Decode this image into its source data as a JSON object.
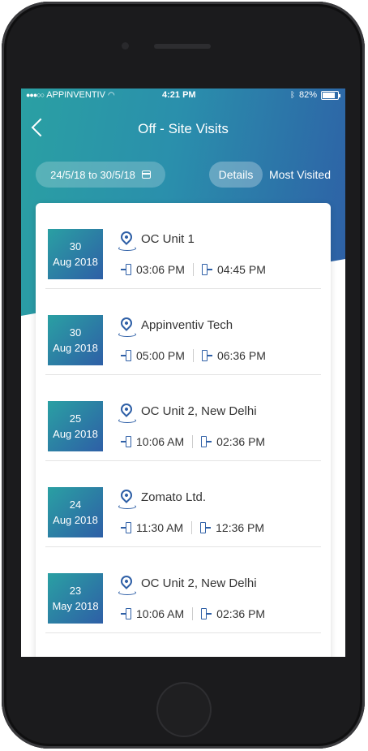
{
  "status_bar": {
    "carrier": "APPINVENTIV",
    "time": "4:21 PM",
    "battery": "82%",
    "icons": [
      "signal-dots-icon",
      "wifi-icon",
      "bluetooth-icon",
      "battery-icon"
    ]
  },
  "header": {
    "title": "Off - Site Visits",
    "back_icon": "chevron-left-icon"
  },
  "filters": {
    "date_range": "24/5/18 to 30/5/18",
    "calendar_icon": "calendar-icon",
    "tabs": [
      {
        "label": "Details",
        "active": true
      },
      {
        "label": "Most Visited",
        "active": false
      }
    ]
  },
  "visits": [
    {
      "day": "30",
      "month_year": "Aug 2018",
      "location": "OC Unit 1",
      "check_in": "03:06 PM",
      "check_out": "04:45 PM"
    },
    {
      "day": "30",
      "month_year": "Aug 2018",
      "location": "Appinventiv Tech",
      "check_in": "05:00 PM",
      "check_out": "06:36 PM"
    },
    {
      "day": "25",
      "month_year": "Aug 2018",
      "location": "OC Unit 2, New Delhi",
      "check_in": "10:06 AM",
      "check_out": "02:36 PM"
    },
    {
      "day": "24",
      "month_year": "Aug 2018",
      "location": "Zomato Ltd.",
      "check_in": "11:30 AM",
      "check_out": "12:36 PM"
    },
    {
      "day": "23",
      "month_year": "May 2018",
      "location": "OC Unit 2, New Delhi",
      "check_in": "10:06 AM",
      "check_out": "02:36 PM"
    }
  ],
  "colors": {
    "gradient_start": "#2aa0a3",
    "gradient_end": "#2e5fa6",
    "icon_blue": "#2e5fa6"
  }
}
